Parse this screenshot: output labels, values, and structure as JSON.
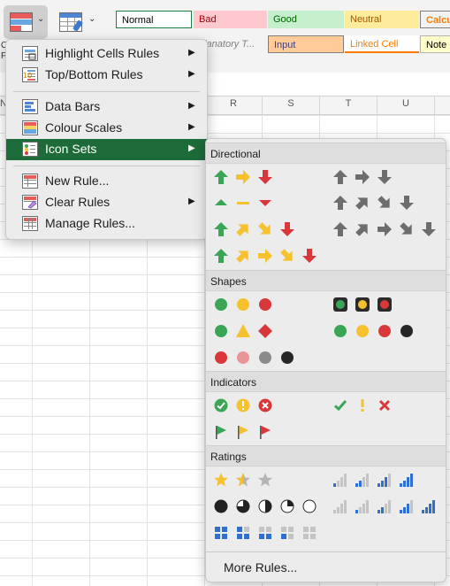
{
  "ribbon": {
    "conditional_formatting_caret": "⌄",
    "format_as_table_caret": "⌄",
    "cell_styles": [
      "Normal",
      "Bad",
      "Good",
      "Neutral",
      "Calcu",
      "planatory T...",
      "Input",
      "Linked Cell",
      "Note"
    ],
    "left_cut_labels": [
      "C",
      "F"
    ]
  },
  "columns": [
    "R",
    "S",
    "T",
    "U"
  ],
  "row_header_cut": "N",
  "menu": {
    "items": [
      {
        "label": "Highlight Cells Rules",
        "icon": "highlight-cells-icon",
        "submenu": true
      },
      {
        "label": "Top/Bottom Rules",
        "icon": "top-bottom-icon",
        "submenu": true
      },
      {
        "label": "Data Bars",
        "icon": "data-bars-icon",
        "submenu": true
      },
      {
        "label": "Colour Scales",
        "icon": "colour-scales-icon",
        "submenu": true
      },
      {
        "label": "Icon Sets",
        "icon": "icon-sets-icon",
        "submenu": true,
        "active": true
      },
      {
        "label": "New Rule...",
        "icon": "new-rule-icon",
        "submenu": false
      },
      {
        "label": "Clear Rules",
        "icon": "clear-rules-icon",
        "submenu": true
      },
      {
        "label": "Manage Rules...",
        "icon": "manage-rules-icon",
        "submenu": false
      }
    ],
    "submenu_arrow": "▶"
  },
  "icon_sets": {
    "sections": [
      "Directional",
      "Shapes",
      "Indicators",
      "Ratings"
    ],
    "more_rules": "More Rules..."
  },
  "colors": {
    "active_item": "#1e6b3a",
    "green": "#3aa655",
    "yellow": "#f5c12e",
    "red": "#d9383a",
    "grey": "#6d6d6d",
    "blue": "#2f6fd1"
  }
}
